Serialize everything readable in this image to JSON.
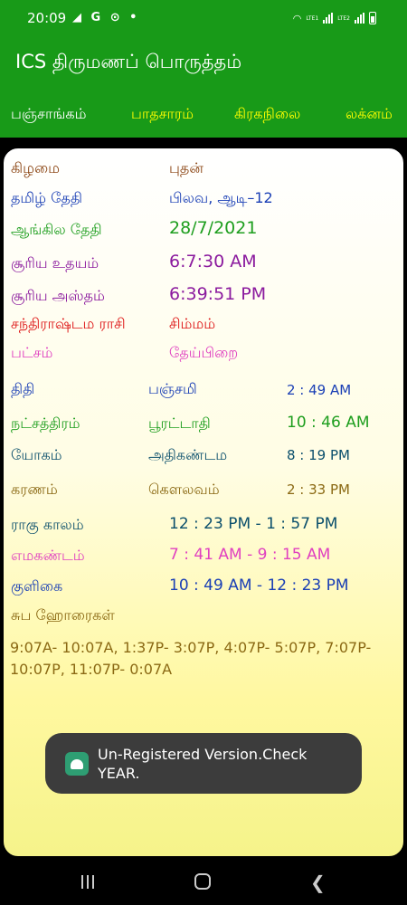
{
  "status_bar": {
    "time": "20:09",
    "left_icons": "◢ G ⊙ •",
    "sim1": "LTE1",
    "sim2": "LTE2"
  },
  "app": {
    "title": "ICS திருமணப் பொருத்தம்"
  },
  "tabs": [
    {
      "label": "பஞ்சாங்கம்",
      "active": true
    },
    {
      "label": "பாதசாரம்",
      "active": false
    },
    {
      "label": "கிரகநிலை",
      "active": false
    },
    {
      "label": "லக்னம்",
      "active": false
    }
  ],
  "panchang": {
    "weekday": {
      "label": "கிழமை",
      "value": "புதன்"
    },
    "tamil_date": {
      "label": "தமிழ் தேதி",
      "value": "பிலவ, ஆடி–12"
    },
    "english_date": {
      "label": "ஆங்கில தேதி",
      "value": "28/7/2021"
    },
    "sunrise": {
      "label": "சூரிய உதயம்",
      "value": "6:7:30 AM"
    },
    "sunset": {
      "label": "சூரிய அஸ்தம்",
      "value": "6:39:51 PM"
    },
    "chandrashtama": {
      "label": "சந்திராஷ்டம ராசி",
      "value": "சிம்மம்"
    },
    "paksha": {
      "label": "பட்சம்",
      "value": "தேய்பிறை"
    },
    "tithi": {
      "label": "திதி",
      "value": "பஞ்சமி",
      "time": "2 : 49 AM"
    },
    "nakshatra": {
      "label": "நட்சத்திரம்",
      "value": "பூரட்டாதி",
      "time": "10 : 46 AM"
    },
    "yoga": {
      "label": "யோகம்",
      "value": "அதிகண்டம",
      "time": "8 : 19 PM"
    },
    "karana": {
      "label": "கரணம்",
      "value": "கௌலவம்",
      "time": "2 : 33 PM"
    },
    "rahu_kalam": {
      "label": "ராகு காலம்",
      "value": "12 : 23 PM - 1 : 57 PM"
    },
    "yamagandam": {
      "label": "எமகண்டம்",
      "value": "7 : 41 AM - 9 : 15 AM"
    },
    "kuligai": {
      "label": "குளிகை",
      "value": "10 : 49 AM - 12 : 23 PM"
    },
    "subha_horai": {
      "label": "சுப ஹோரைகள்",
      "value": "9:07A- 10:07A,  1:37P- 3:07P,  4:07P- 5:07P,  7:07P- 10:07P,  11:07P- 0:07A"
    }
  },
  "toast": {
    "message": "Un-Registered Version.Check YEAR."
  },
  "colors": {
    "app_bar": "#189a18",
    "tab_inactive": "#ffff00",
    "tab_indicator": "#a52a2a",
    "brown": "#8b4513",
    "blue": "#1a3fb5",
    "green": "#1e9e1e",
    "purple": "#8b1a9e",
    "red": "#dd1111",
    "magenta": "#e040c0",
    "olive": "#8b6914",
    "teal": "#0b4f6c"
  }
}
